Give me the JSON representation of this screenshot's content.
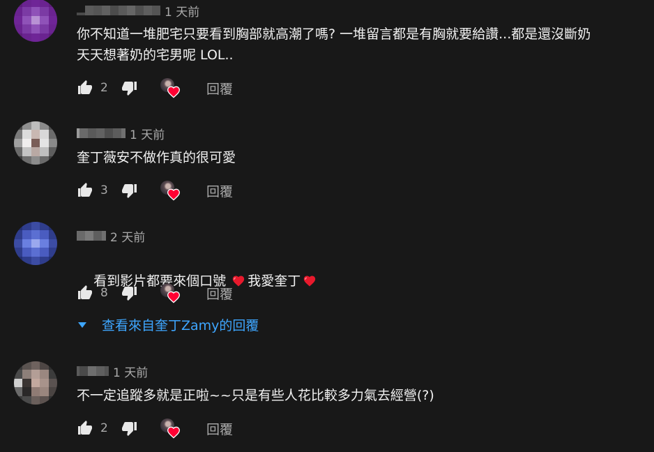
{
  "comments": [
    {
      "time": "1 天前",
      "text": "你不知道一堆肥宅只要看到胸部就高潮了嗎? 一堆留言都是有胸就要給讚...都是還沒斷奶\n天天想著奶的宅男呢 LOL..",
      "likes": "2",
      "reply_label": "回覆"
    },
    {
      "time": "1 天前",
      "text": "奎丁薇安不做作真的很可愛",
      "likes": "3",
      "reply_label": "回覆"
    },
    {
      "time": "2 天前",
      "text_part1": "看到影片都要來個口號",
      "text_part2": "我愛奎丁",
      "likes": "8",
      "reply_label": "回覆",
      "view_replies": "查看來自奎丁Zamy的回覆"
    },
    {
      "time": "1 天前",
      "text": "不一定追蹤多就是正啦~~只是有些人花比較多力氣去經營(?)",
      "likes": "2",
      "reply_label": "回覆"
    }
  ],
  "icons": [
    "thumb-up-icon",
    "thumb-down-icon",
    "creator-heart-icon",
    "heart-emoji-icon",
    "caret-down-icon"
  ],
  "colors": {
    "background": "#181818",
    "text": "#f1f1f1",
    "secondary": "#aaaaaa",
    "link": "#3ea6ff",
    "heart": "#ff0033"
  }
}
